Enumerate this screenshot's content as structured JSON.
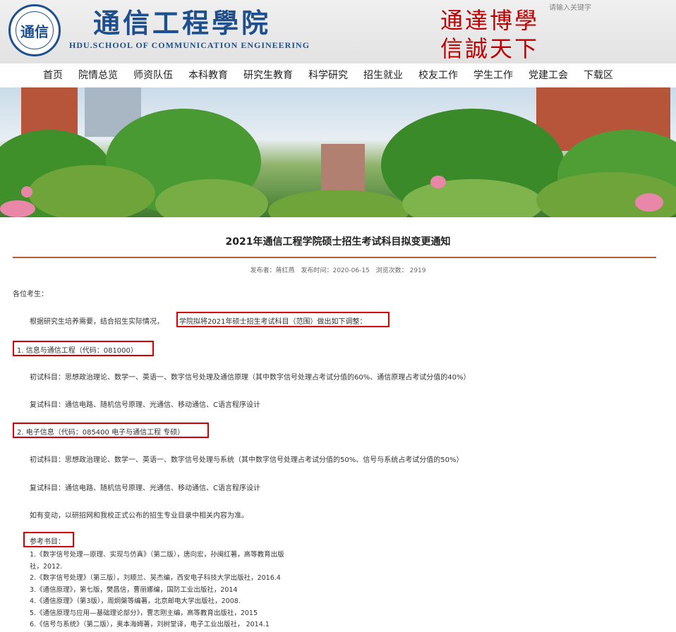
{
  "header": {
    "title": "通信工程學院",
    "subtitle": "HDU.SCHOOL OF COMMUNICATION ENGINEERING",
    "logo_char": "通信",
    "motto_line1": "通達博學",
    "motto_line2": "信誠天下",
    "search_placeholder": "请输入关键字"
  },
  "nav": [
    "首页",
    "院情总览",
    "师资队伍",
    "本科教育",
    "研究生教育",
    "科学研究",
    "招生就业",
    "校友工作",
    "学生工作",
    "党建工会",
    "下载区"
  ],
  "article": {
    "title": "2021年通信工程学院硕士招生考试科目拟变更通知",
    "meta": {
      "publisher": "发布者：蒋红燕",
      "time": "发布时间：2020-06-15",
      "views": "浏览次数： 2919"
    },
    "greeting": "各位考生：",
    "intro_pre": "根据研究生培养需要，结合招生实际情况，",
    "intro_hl": "学院拟将2021年硕士招生考试科目（范围）做出如下调整：",
    "s1_head": "1. 信息与通信工程（代码：081000）",
    "s1_first": "初试科目：思想政治理论、数学一、英语一、数字信号处理及通信原理（其中数字信号处理占考试分值的60%、通信原理占考试分值的40%）",
    "s1_second": "复试科目：通信电路、随机信号原理、光通信、移动通信、C语言程序设计",
    "s2_head": "2. 电子信息（代码：085400 电子与通信工程 专硕）",
    "s2_first": "初试科目：思想政治理论、数学一、英语一、数字信号处理与系统（其中数字信号处理占考试分值的50%、信号与系统占考试分值的50%）",
    "s2_second": "复试科目：通信电路、随机信号原理、光通信、移动通信、C语言程序设计",
    "note": "如有变动，以研招网和我校正式公布的招生专业目录中相关内容为准。",
    "ref_head": "参考书目：",
    "refs": [
      "1.《数字信号处理—原理、实现与仿真》（第二版），唐向宏，孙闽红著，高等教育出版",
      "社，2012.",
      "2.《数字信号处理》（第三版），刘顺兰、吴杰编，西安电子科技大学出版社，2016.4",
      "3.《通信原理》，第七版，樊昌信，曹丽娜编，国防工业出版社，2014",
      "4.《通信原理》（第3版），周炯槃等编著，北京邮电大学出版社，2008.",
      "5.《通信原理与应用—基础理论部分》，曹志刚主编，高等教育出版社，2015",
      "6.《信号与系统》（第二版），奥本海姆著，刘树堂译，电子工业出版社， 2014.1"
    ]
  }
}
